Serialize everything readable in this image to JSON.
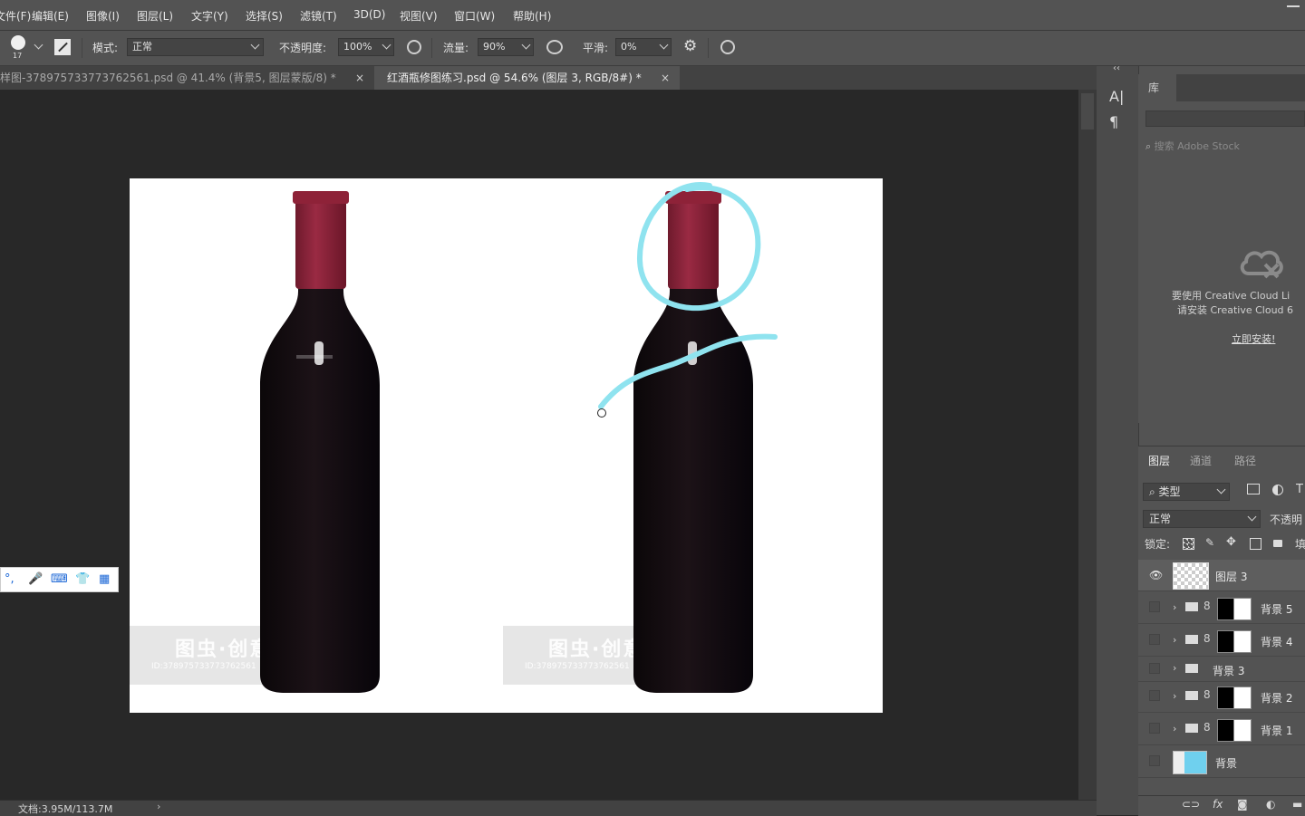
{
  "menu": {
    "items": [
      "文件(F)",
      "编辑(E)",
      "图像(I)",
      "图层(L)",
      "文字(Y)",
      "选择(S)",
      "滤镜(T)",
      "3D(D)",
      "视图(V)",
      "窗口(W)",
      "帮助(H)"
    ]
  },
  "options": {
    "brush_size": "17",
    "mode_label": "模式:",
    "mode_value": "正常",
    "opacity_label": "不透明度:",
    "opacity_value": "100%",
    "flow_label": "流量:",
    "flow_value": "90%",
    "smooth_label": "平滑:",
    "smooth_value": "0%"
  },
  "tabs": [
    {
      "title": "样图-378975733773762561.psd @ 41.4% (背景5, 图层蒙版/8) *",
      "close": "×"
    },
    {
      "title": "红酒瓶修图练习.psd @ 54.6% (图层 3, RGB/8#) *",
      "close": "×"
    }
  ],
  "canvas": {
    "watermark_text": "图虫·创意",
    "watermark_id": "ID:378975733773762561",
    "annotation_color": "#8fe3ef"
  },
  "ime": {
    "icons": [
      "punctuation-icon",
      "microphone-icon",
      "keyboard-icon",
      "skin-icon",
      "apps-icon"
    ],
    "glyphs": [
      "°,",
      "🎤",
      "⌨",
      "👕",
      "▦"
    ]
  },
  "status": {
    "doc_info": "文档:3.95M/113.7M",
    "arrow": "›"
  },
  "libraries": {
    "tab_label": "库",
    "search_placeholder": "搜索 Adobe Stock",
    "message_line1": "要使用 Creative Cloud Li",
    "message_line2": "请安装 Creative Cloud 6",
    "install_link": "立即安装!"
  },
  "strip": {
    "char_icon": "A|",
    "para_icon": "¶"
  },
  "layers_panel": {
    "tabs": [
      "图层",
      "通道",
      "路径"
    ],
    "filter_value": "类型",
    "blend_value": "正常",
    "opacity_label": "不透明",
    "lock_label": "锁定:",
    "lock_extra": "填",
    "layers": [
      {
        "name": "图层 3",
        "visible": true,
        "type": "pixel",
        "active": true
      },
      {
        "name": "背景 5",
        "visible": false,
        "type": "group-mask"
      },
      {
        "name": "背景 4",
        "visible": false,
        "type": "group-mask"
      },
      {
        "name": "背景 3",
        "visible": false,
        "type": "group"
      },
      {
        "name": "背景 2",
        "visible": false,
        "type": "group-mask"
      },
      {
        "name": "背景 1",
        "visible": false,
        "type": "group-mask"
      },
      {
        "name": "背景",
        "visible": false,
        "type": "bg"
      }
    ]
  }
}
